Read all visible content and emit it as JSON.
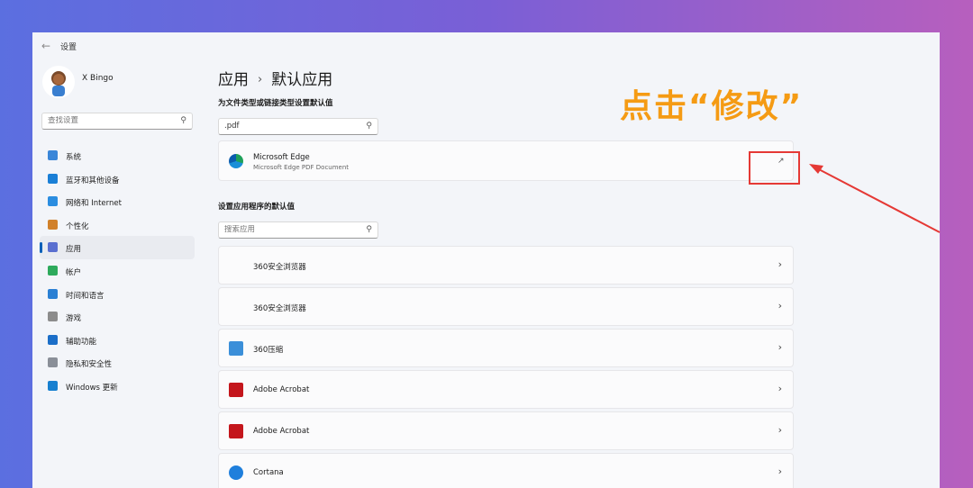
{
  "window": {
    "title": "设置"
  },
  "user": {
    "name": "X Bingo"
  },
  "sidebar": {
    "search_placeholder": "查找设置",
    "items": [
      {
        "label": "系统",
        "color": "#3a86d8"
      },
      {
        "label": "蓝牙和其他设备",
        "color": "#1a7fd6"
      },
      {
        "label": "网络和 Internet",
        "color": "#2b8de0"
      },
      {
        "label": "个性化",
        "color": "#d1812a"
      },
      {
        "label": "应用",
        "color": "#5a6fd0",
        "active": true
      },
      {
        "label": "帐户",
        "color": "#2eaa5c"
      },
      {
        "label": "时间和语言",
        "color": "#2a80d4"
      },
      {
        "label": "游戏",
        "color": "#8c8c8c"
      },
      {
        "label": "辅助功能",
        "color": "#1b6ec8"
      },
      {
        "label": "隐私和安全性",
        "color": "#8a8f98"
      },
      {
        "label": "Windows 更新",
        "color": "#1780d0"
      }
    ]
  },
  "main": {
    "breadcrumb": {
      "parent": "应用",
      "current": "默认应用"
    },
    "filetype_section": {
      "title": "为文件类型或链接类型设置默认值",
      "search_value": ".pdf",
      "result": {
        "app_name": "Microsoft Edge",
        "description": "Microsoft Edge PDF Document"
      }
    },
    "apps_section": {
      "title": "设置应用程序的默认值",
      "search_placeholder": "搜索应用",
      "apps": [
        {
          "label": "360安全浏览器",
          "icon_color": ""
        },
        {
          "label": "360安全浏览器",
          "icon_color": ""
        },
        {
          "label": "360压缩",
          "icon_color": "#3b8fd9"
        },
        {
          "label": "Adobe Acrobat",
          "icon_color": "#c4161c"
        },
        {
          "label": "Adobe Acrobat",
          "icon_color": "#c4161c"
        },
        {
          "label": "Cortana",
          "icon_color": "#1f7fdc"
        }
      ]
    }
  },
  "annotation": {
    "text": "点击“修改”",
    "color": "#f59b14"
  }
}
